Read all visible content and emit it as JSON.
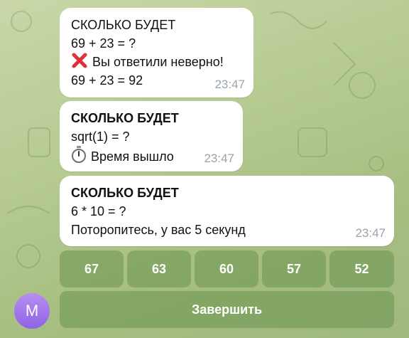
{
  "messages": [
    {
      "lines": [
        "СКОЛЬКО БУДЕТ",
        "69 + 23 = ?",
        "Вы ответили неверно!",
        "69 + 23 = 92"
      ],
      "time": "23:47"
    },
    {
      "lines": [
        "СКОЛЬКО БУДЕТ",
        "sqrt(1) = ?",
        "Время вышло"
      ],
      "time": "23:47"
    },
    {
      "lines": [
        "СКОЛЬКО БУДЕТ",
        "6 * 10 = ?",
        "Поторопитесь, у вас 5 секунд"
      ],
      "time": "23:47"
    }
  ],
  "keyboard": {
    "answers": [
      "67",
      "63",
      "60",
      "57",
      "52"
    ],
    "finish": "Завершить"
  },
  "avatar": {
    "initial": "M"
  },
  "icons": {
    "wrong": "cross-mark-icon",
    "timer": "stopwatch-icon"
  },
  "colors": {
    "accent": "#8f63e6",
    "wrong": "#e0313b",
    "button": "#6f9a52"
  }
}
